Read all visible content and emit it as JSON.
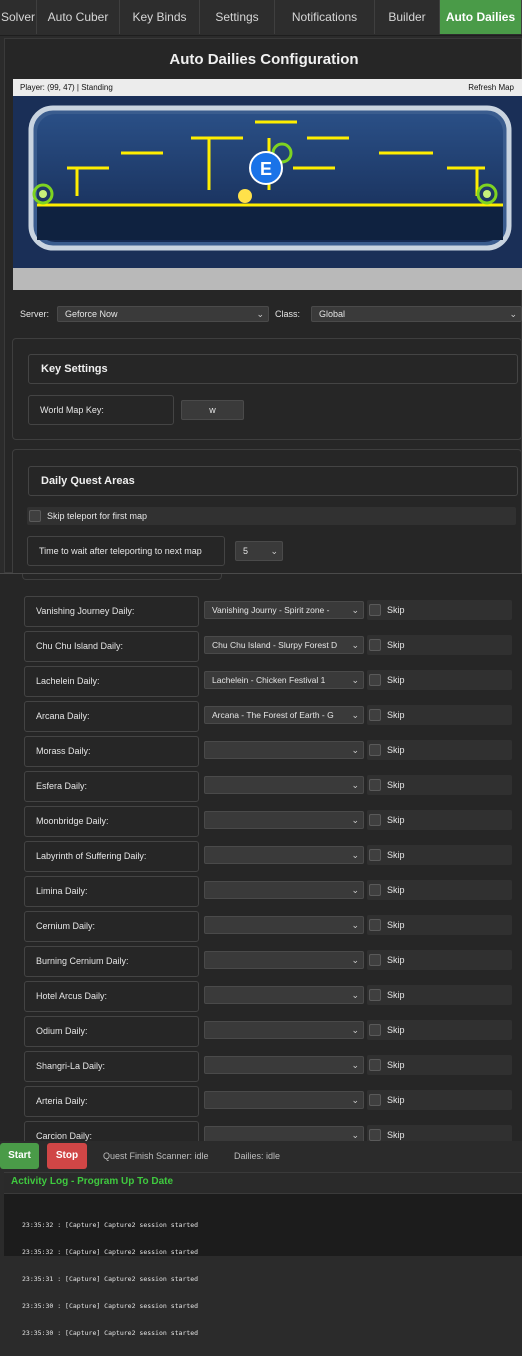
{
  "tabs": [
    {
      "label": "Solver",
      "active": false
    },
    {
      "label": "Auto Cuber",
      "active": false
    },
    {
      "label": "Key Binds",
      "active": false
    },
    {
      "label": "Settings",
      "active": false
    },
    {
      "label": "Notifications",
      "active": false
    },
    {
      "label": "Builder",
      "active": false
    },
    {
      "label": "Auto Dailies",
      "active": true
    }
  ],
  "panel": {
    "title": "Auto Dailies Configuration"
  },
  "map": {
    "player_status": "Player: (99, 47)  |  Standing",
    "refresh_label": "Refresh Map",
    "marker_letter": "E"
  },
  "server": {
    "label": "Server:",
    "value": "Geforce Now"
  },
  "class_select": {
    "label": "Class:",
    "value": "Global"
  },
  "key_settings": {
    "title": "Key Settings",
    "world_map_key_label": "World Map Key:",
    "world_map_key_value": "w"
  },
  "daily_quest_areas": {
    "title": "Daily Quest Areas",
    "skip_teleport_label": "Skip teleport for first map",
    "wait_label": "Time to wait after teleporting to next map",
    "wait_value": "5"
  },
  "skip_label": "Skip",
  "dailies": [
    {
      "name": "Vanishing Journey Daily:",
      "value": "Vanishing Journy - Spirit zone -"
    },
    {
      "name": "Chu Chu Island Daily:",
      "value": "Chu Chu Island - Slurpy Forest D"
    },
    {
      "name": "Lachelein Daily:",
      "value": "Lachelein - Chicken Festival 1"
    },
    {
      "name": "Arcana Daily:",
      "value": "Arcana - The Forest of Earth - G"
    },
    {
      "name": "Morass Daily:",
      "value": ""
    },
    {
      "name": "Esfera Daily:",
      "value": ""
    },
    {
      "name": "Moonbridge Daily:",
      "value": ""
    },
    {
      "name": "Labyrinth of Suffering Daily:",
      "value": ""
    },
    {
      "name": "Limina Daily:",
      "value": ""
    },
    {
      "name": "Cernium Daily:",
      "value": ""
    },
    {
      "name": "Burning Cernium Daily:",
      "value": ""
    },
    {
      "name": "Hotel Arcus Daily:",
      "value": ""
    },
    {
      "name": "Odium Daily:",
      "value": ""
    },
    {
      "name": "Shangri-La Daily:",
      "value": ""
    },
    {
      "name": "Arteria Daily:",
      "value": ""
    },
    {
      "name": "Carcion Daily:",
      "value": ""
    }
  ],
  "controls": {
    "start_label": "Start",
    "stop_label": "Stop",
    "scanner_status": "Quest Finish Scanner: idle",
    "dailies_status": "Dailies: idle"
  },
  "log": {
    "title": "Activity Log - Program Up To Date",
    "lines": [
      "23:35:32 : [Capture] Capture2 session started",
      "23:35:32 : [Capture] Capture2 session started",
      "23:35:31 : [Capture] Capture2 session started",
      "23:35:30 : [Capture] Capture2 session started",
      "23:35:30 : [Capture] Capture2 session started"
    ]
  },
  "colors": {
    "accent_green": "#4a9b48",
    "stop_red": "#d04646",
    "log_title_green": "#3fc93f",
    "map_platform_yellow": "#ffee00",
    "map_marker_blue": "#1a73e8"
  }
}
